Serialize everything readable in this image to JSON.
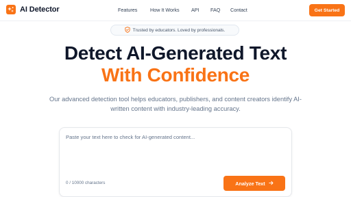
{
  "brand": {
    "name": "AI Detector",
    "accent_color": "#f97316",
    "icon": "sparkle-icon"
  },
  "nav": {
    "links": [
      "Features",
      "How It Works",
      "API",
      "FAQ",
      "Contact"
    ],
    "cta_label": "Get Started"
  },
  "badge": {
    "icon": "shield-check-icon",
    "text": "Trusted by educators. Loved by professionals."
  },
  "hero": {
    "title": "Detect AI-Generated Text",
    "accent": "With Confidence",
    "subtitle": "Our advanced detection tool helps educators, publishers, and content creators identify AI-written content with industry-leading accuracy."
  },
  "analyzer": {
    "placeholder": "Paste your text here to check for AI-generated content...",
    "value": "",
    "char_count": "0 / 10000 characters",
    "button_label": "Analyze Text",
    "button_icon": "arrow-right-icon"
  }
}
